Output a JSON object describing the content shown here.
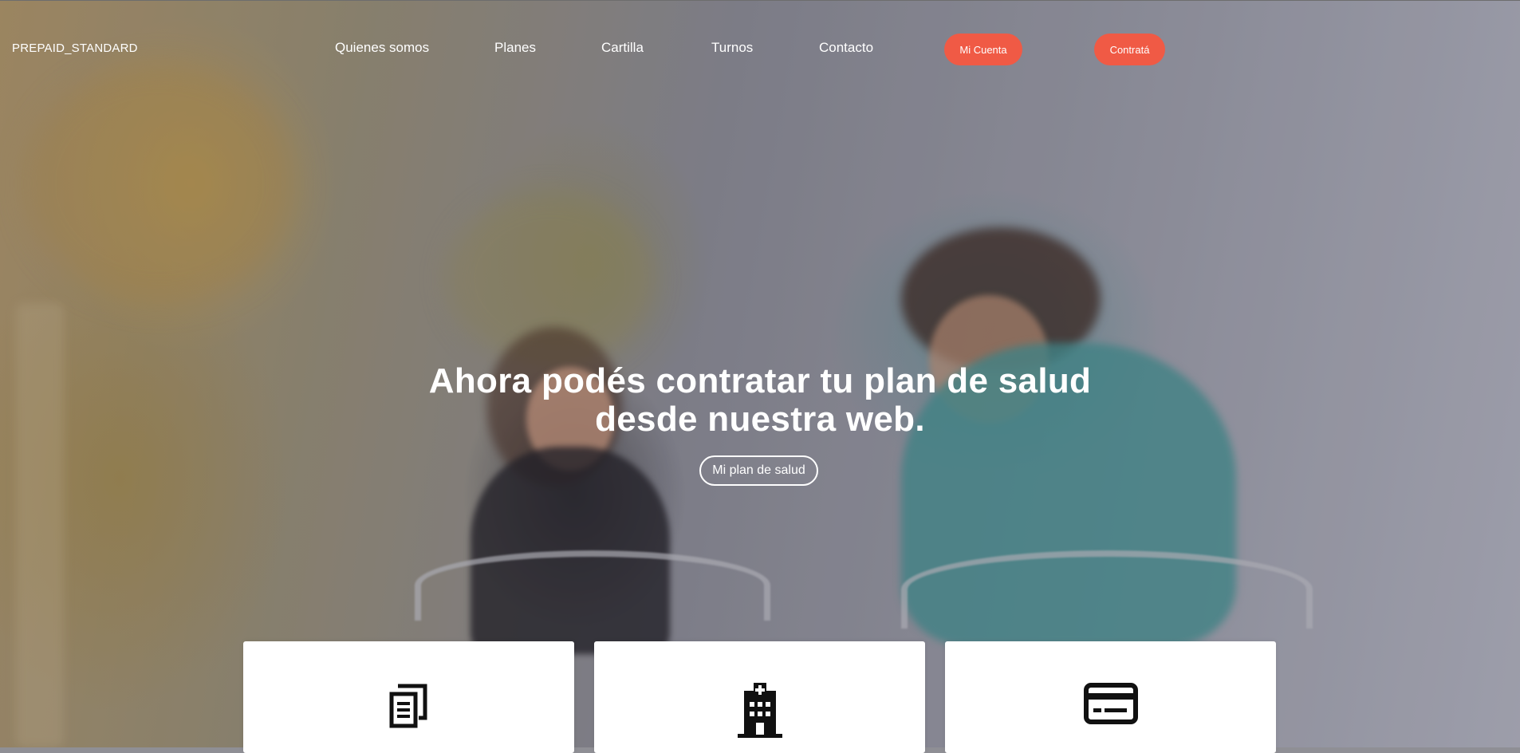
{
  "brand": {
    "name": "PREPAID_STANDARD"
  },
  "nav": {
    "links": [
      {
        "label": "Quienes somos"
      },
      {
        "label": "Planes"
      },
      {
        "label": "Cartilla"
      },
      {
        "label": "Turnos"
      },
      {
        "label": "Contacto"
      }
    ],
    "account_label": "Mi Cuenta",
    "contract_label": "Contratá"
  },
  "hero": {
    "title_line1": "Ahora podés contratar tu plan de salud",
    "title_line2": "desde nuestra web.",
    "cta_label": "Mi plan de salud"
  },
  "cards": [
    {
      "icon": "documents-icon"
    },
    {
      "icon": "hospital-icon"
    },
    {
      "icon": "credit-card-icon"
    }
  ],
  "colors": {
    "accent": "#f05a45",
    "text_on_hero": "#ffffff",
    "card_background": "#ffffff",
    "icon": "#111111"
  }
}
